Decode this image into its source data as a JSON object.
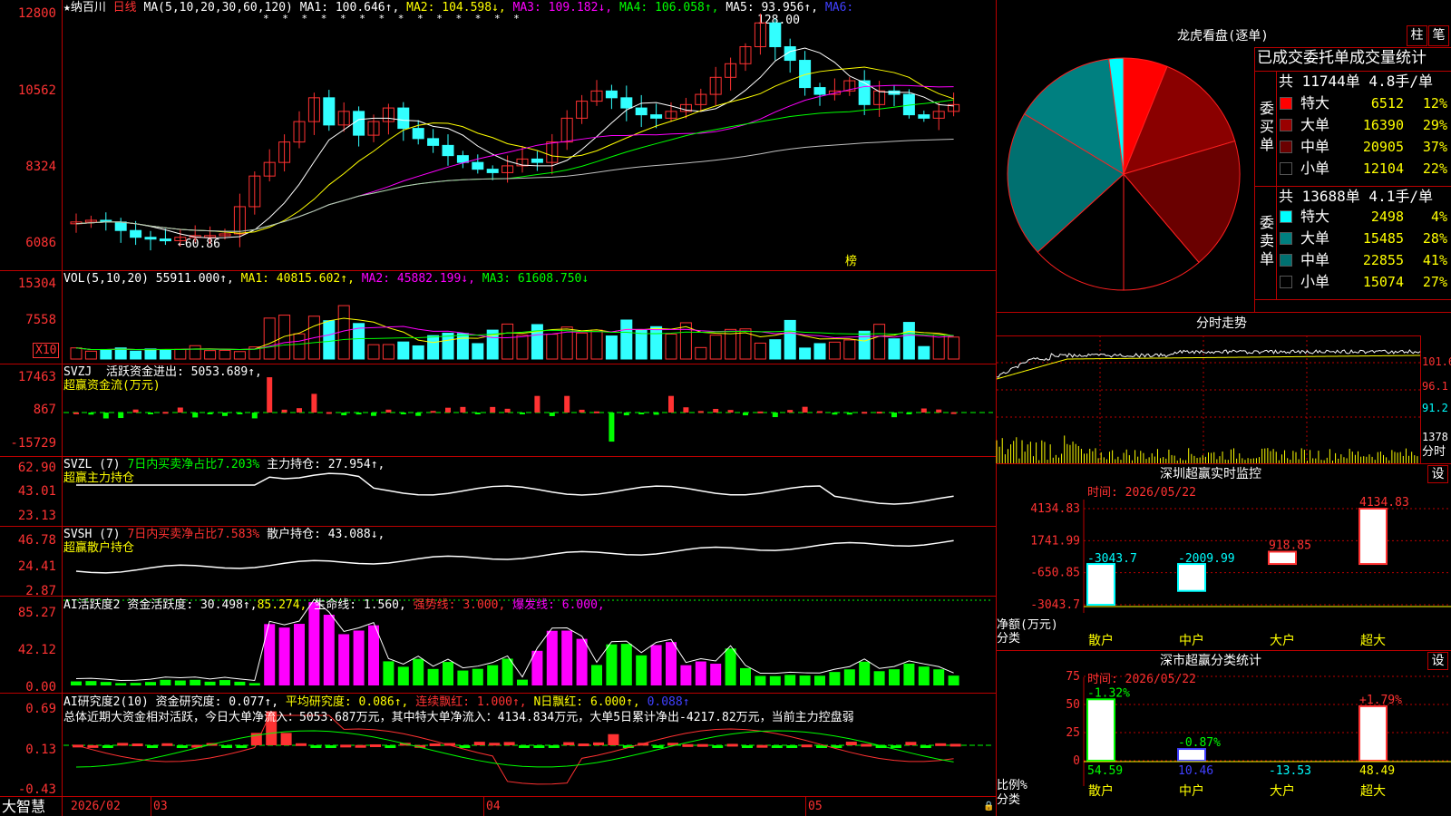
{
  "colors": {
    "up": "#ff3232",
    "down": "#32ffff",
    "grid": "#b00000",
    "ma1": "#ffffff",
    "ma2": "#ffff00",
    "ma3": "#ff00ff",
    "ma4": "#00ff00",
    "ma5": "#c0c0c0",
    "ma6": "#4040ff"
  },
  "main": {
    "star": "★",
    "name": "纳百川",
    "period": "日线",
    "ma_params": "MA(5,10,20,30,60,120)",
    "ma1": "MA1: 100.646↑,",
    "ma2": "MA2: 104.598↓,",
    "ma3": "MA3: 109.182↓,",
    "ma4": "MA4: 106.058↑,",
    "ma5": "MA5: 93.956↑,",
    "ma6": "MA6:",
    "high_mark": "128.00",
    "low_mark": "←60.86",
    "bang": "榜",
    "y": [
      "12800",
      "10562",
      "8324",
      "6086"
    ],
    "stars": "* * * * * * * * * * * * * *"
  },
  "vol": {
    "title": "VOL(5,10,20)",
    "value": "55911.000↑,",
    "ma1": "MA1: 40815.602↑,",
    "ma2": "MA2: 45882.199↓,",
    "ma3": "MA3: 61608.750↓",
    "y": [
      "15304",
      "7558"
    ],
    "x10": "X10"
  },
  "svzj": {
    "title": "SVZJ",
    "label": "活跃资金进出: 5053.689↑,",
    "sub": "超赢资金流(万元)",
    "y": [
      "17463",
      "867",
      "-15729"
    ]
  },
  "svzl": {
    "title": "SVZL (7)",
    "pct": "7日内买卖净占比7.203%",
    "hold": "主力持仓: 27.954↑,",
    "sub": "超赢主力持仓",
    "y": [
      "62.90",
      "43.01",
      "23.13"
    ]
  },
  "svsh": {
    "title": "SVSH (7)",
    "pct": "7日内买卖净占比7.583%",
    "hold": "散户持仓: 43.088↓,",
    "sub": "超赢散户持仓",
    "y": [
      "46.78",
      "24.41",
      "2.87"
    ]
  },
  "ai1": {
    "title": "AI活跃度2",
    "a": "资金活跃度: 30.498↑,",
    "b": "85.274,",
    "c": "生命线: 1.560,",
    "d": "强势线: 3.000,",
    "e": "爆发线: 6.000,",
    "y": [
      "85.27",
      "42.12",
      "0.00"
    ]
  },
  "ai2": {
    "title": "AI研究度2(10)",
    "a": "资金研究度: 0.077↑,",
    "b": "平均研究度: 0.086↑,",
    "c": "连续飘红: 1.000↑,",
    "d": "N日飘红: 6.000↑,",
    "e": "0.088↑",
    "summary": "总体近期大资金相对活跃，今日大单净流入：5053.687万元，其中特大单净流入：4134.834万元，大单5日累计净出-4217.82万元，当前主力控盘弱",
    "y": [
      "0.69",
      "0.13",
      "-0.43"
    ]
  },
  "footer": {
    "brand": "大智慧",
    "d1": "2026/02",
    "d2": "03",
    "d3": "04",
    "d4": "05",
    "lock": "🔒"
  },
  "longhu": {
    "title": "龙虎看盘(逐单)",
    "btn1": "柱",
    "btn2": "笔",
    "stat_title": "已成交委托单成交量统计",
    "buy_total": "共 11744单 4.8手/单",
    "sell_total": "共 13688单 4.1手/单",
    "buy_side": "委买单",
    "sell_side": "委卖单",
    "buy": [
      {
        "k": "特大",
        "v": "6512",
        "p": "12%",
        "c": "#ff0000"
      },
      {
        "k": "大单",
        "v": "16390",
        "p": "29%",
        "c": "#9a0000"
      },
      {
        "k": "中单",
        "v": "20905",
        "p": "37%",
        "c": "#6a0000"
      },
      {
        "k": "小单",
        "v": "12104",
        "p": "22%",
        "c": "#000000"
      }
    ],
    "sell": [
      {
        "k": "特大",
        "v": "2498",
        "p": "4%",
        "c": "#00ffff"
      },
      {
        "k": "大单",
        "v": "15485",
        "p": "28%",
        "c": "#008080"
      },
      {
        "k": "中单",
        "v": "22855",
        "p": "41%",
        "c": "#007070"
      },
      {
        "k": "小单",
        "v": "15074",
        "p": "27%",
        "c": "#000000"
      }
    ]
  },
  "fenshi": {
    "title": "分时走势",
    "y1": "101.6",
    "y2": "96.1",
    "y3": "91.2",
    "vol": "1378",
    "unit": "分时"
  },
  "sz": {
    "title": "深圳超赢实时监控",
    "btn": "设",
    "time": "时间: 2026/05/22",
    "y": [
      "4134.83",
      "1741.99",
      "-650.85",
      "-3043.7"
    ],
    "ylab": "净额(万元)",
    "xlab": "分类",
    "cats": [
      "散户",
      "中户",
      "大户",
      "超大"
    ],
    "vals": [
      -3043.7,
      -2009.99,
      918.85,
      4134.83
    ],
    "labels": [
      "-3043.7",
      "-2009.99",
      "918.85",
      "4134.83"
    ]
  },
  "ss": {
    "title": "深市超赢分类统计",
    "btn": "设",
    "time": "时间: 2026/05/22",
    "y": [
      "75",
      "50",
      "25",
      "0"
    ],
    "ylab": "比例%",
    "xlab": "分类",
    "cats": [
      "散户",
      "中户",
      "大户",
      "超大"
    ],
    "top": [
      "-1.32%",
      "-0.87%",
      "",
      "+1.79%"
    ],
    "bottom": [
      "54.59",
      "10.46",
      "-13.53",
      "48.49"
    ],
    "vals": [
      54.59,
      10.46,
      0,
      48.49
    ]
  }
}
